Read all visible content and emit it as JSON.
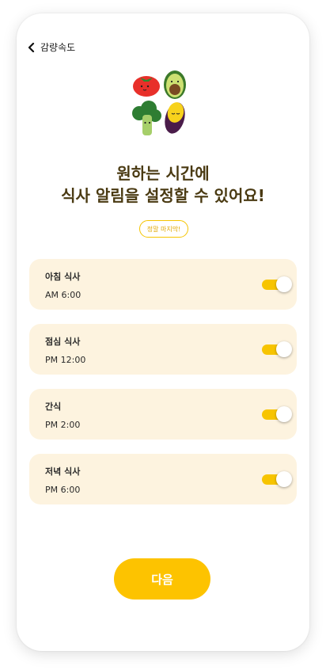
{
  "header": {
    "back_icon": "chevron-left-icon",
    "title": "감량속도"
  },
  "illustration": {
    "icon": "vegetable-characters-illustration"
  },
  "headline": {
    "line1": "원하는 시간에",
    "line2": "식사 알림을 설정할 수 있어요!"
  },
  "tag": {
    "label": "정말 마지막!"
  },
  "meals": [
    {
      "name": "아침 식사",
      "time": "AM 6:00",
      "enabled": true
    },
    {
      "name": "점심 식사",
      "time": "PM 12:00",
      "enabled": true
    },
    {
      "name": "간식",
      "time": "PM 2:00",
      "enabled": true
    },
    {
      "name": "저녁 식사",
      "time": "PM 6:00",
      "enabled": true
    }
  ],
  "next_button": {
    "label": "다음"
  },
  "colors": {
    "accent": "#fdc300",
    "card_bg": "#fdf3df",
    "headline": "#4a3a12"
  }
}
